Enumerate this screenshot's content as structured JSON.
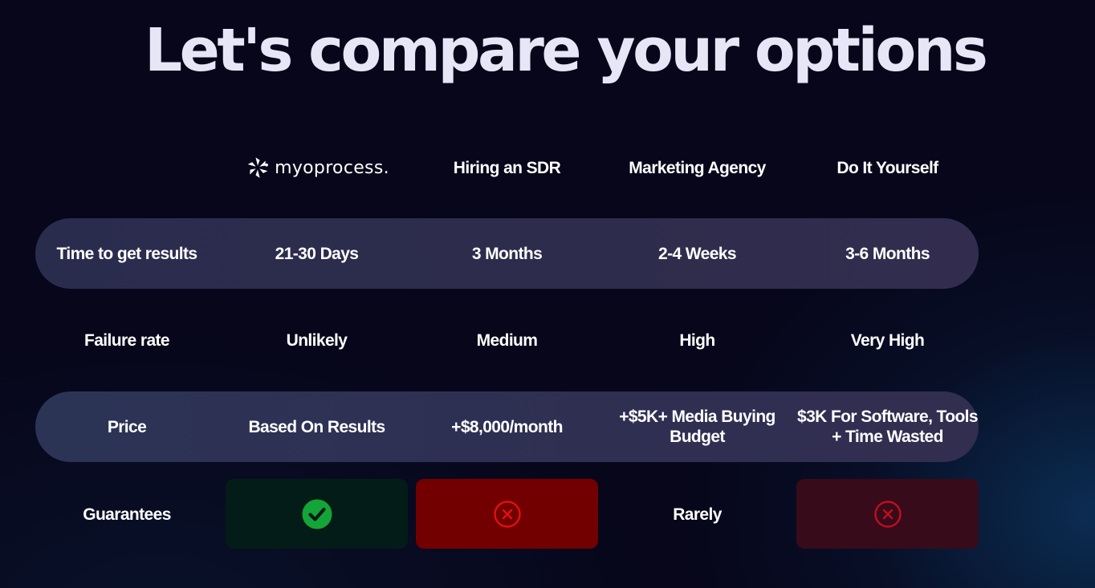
{
  "title": "Let's compare your options",
  "columns": {
    "brand": "myoprocess.",
    "col2": "Hiring an SDR",
    "col3": "Marketing Agency",
    "col4": "Do It Yourself"
  },
  "rows": [
    {
      "label": "Time to get results",
      "values": [
        "21-30 Days",
        "3 Months",
        "2-4 Weeks",
        "3-6 Months"
      ]
    },
    {
      "label": "Failure rate",
      "values": [
        "Unlikely",
        "Medium",
        "High",
        "Very High"
      ]
    },
    {
      "label": "Price",
      "values": [
        "Based On Results",
        "+$8,000/month",
        "+$5K+ Media Buying Budget",
        "$3K For Software, Tools + Time Wasted"
      ]
    }
  ],
  "guarantees": {
    "label": "Guarantees",
    "brand": "check-icon",
    "col2": "x-circle-icon",
    "col3": "Rarely",
    "col4": "x-circle-icon"
  },
  "colors": {
    "check": "#13a538",
    "x_strong": "#e01010",
    "x_dim": "#c00e1e",
    "band": "#2e2c4c"
  }
}
